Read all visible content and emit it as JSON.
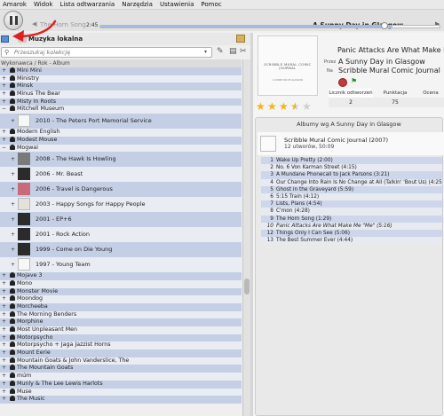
{
  "menubar": [
    "Amarok",
    "Widok",
    "Lista odtwarzania",
    "Narzędzia",
    "Ustawienia",
    "Pomoc"
  ],
  "player": {
    "prev_track": "The Horn Song",
    "now_playing": "A Sunny Day in Glasgow",
    "elapsed": "2:45",
    "progress": 0.86
  },
  "panel": {
    "title": "Muzyka lokalna",
    "search_placeholder": "Przeszukaj kolekcję",
    "column_header": "Wykonawca / Rok - Album"
  },
  "collection": {
    "before": [
      "Mini Mini",
      "Ministry",
      "Minsk",
      "Minus The Bear",
      "Misty In Roots",
      "Mitchell Museum"
    ],
    "mitchell_album": "2010 - The Peters Port Memorial Service",
    "middle": [
      "Modern English",
      "Modest Mouse",
      "Mogwai"
    ],
    "mogwai_albums": [
      {
        "label": "2008 - The Hawk Is Howling",
        "cover": "grey"
      },
      {
        "label": "2006 - Mr. Beast",
        "cover": "dark"
      },
      {
        "label": "2006 - Travel is Dangerous",
        "cover": "pink"
      },
      {
        "label": "2003 - Happy Songs for Happy People",
        "cover": "light"
      },
      {
        "label": "2001 - EP+6",
        "cover": "dark"
      },
      {
        "label": "2001 - Rock Action",
        "cover": "dark"
      },
      {
        "label": "1999 - Come on Die Young",
        "cover": "dark"
      },
      {
        "label": "1997 - Young Team",
        "cover": "white"
      }
    ],
    "after": [
      "Mojave 3",
      "Mono",
      "Monster Movie",
      "Moondog",
      "Morcheeba",
      "The Morning Benders",
      "Morphine",
      "Most Unpleasant Men",
      "Motorpsycho",
      "Motorpsycho + Jaga Jazzist Horns",
      "Mount Eerie",
      "Mountain Goats & John Vanderslice, The",
      "The Mountain Goats",
      "múm",
      "Munly & The Lee Lewis Harlots",
      "Muse",
      "The Music"
    ]
  },
  "context": {
    "track_title": "Panic Attacks Are What Make Me",
    "artist_prefix": "Przez",
    "artist": "A Sunny Day in Glasgow",
    "album_prefix": "Na",
    "album": "Scribble Mural Comic Journal",
    "stats_headers": [
      "Licznik odtworzeń",
      "Punktacja",
      "Ocena"
    ],
    "stats_values": [
      "2",
      "75",
      ""
    ],
    "rating": 3.5,
    "albums_title": "Albumy wg A Sunny Day in Glasgow",
    "album_entry": "Scribble Mural Comic Journal (2007)",
    "album_meta": "12 utworów,  50:09",
    "tracks": [
      {
        "n": "1",
        "t": "Wake Up Pretty (2:00)"
      },
      {
        "n": "2",
        "t": "No. 6 Von Karman Street (4:15)"
      },
      {
        "n": "3",
        "t": "A Mundane Phonecall to Jack Parsons (3:21)"
      },
      {
        "n": "4",
        "t": "Our Change Into Rain Is No Change at All (Talkin' 'Bout Us) (4:25)"
      },
      {
        "n": "5",
        "t": "Ghost in the Graveyard (5:59)"
      },
      {
        "n": "6",
        "t": "5:15 Train (4:12)"
      },
      {
        "n": "7",
        "t": "Lists, Plans (4:54)"
      },
      {
        "n": "8",
        "t": "C'mon (4:28)"
      },
      {
        "n": "9",
        "t": "The Horn Song (1:29)"
      },
      {
        "n": "10",
        "t": "Panic Attacks Are What Make Me \"Me\" (5:16)",
        "current": true
      },
      {
        "n": "12",
        "t": "Things Only I Can See (5:06)"
      },
      {
        "n": "13",
        "t": "The Best Summer Ever (4:44)"
      }
    ],
    "cover_text": "SCRIBBLE MURAL COMIC JOURNAL",
    "cover_sub": "A SUNNY DAY IN GLASGOW"
  },
  "colors": {
    "row_odd": "#c4cfe5",
    "row_even": "#e9ecf3",
    "star": "#f0b41d",
    "annotation": "#e02020"
  }
}
